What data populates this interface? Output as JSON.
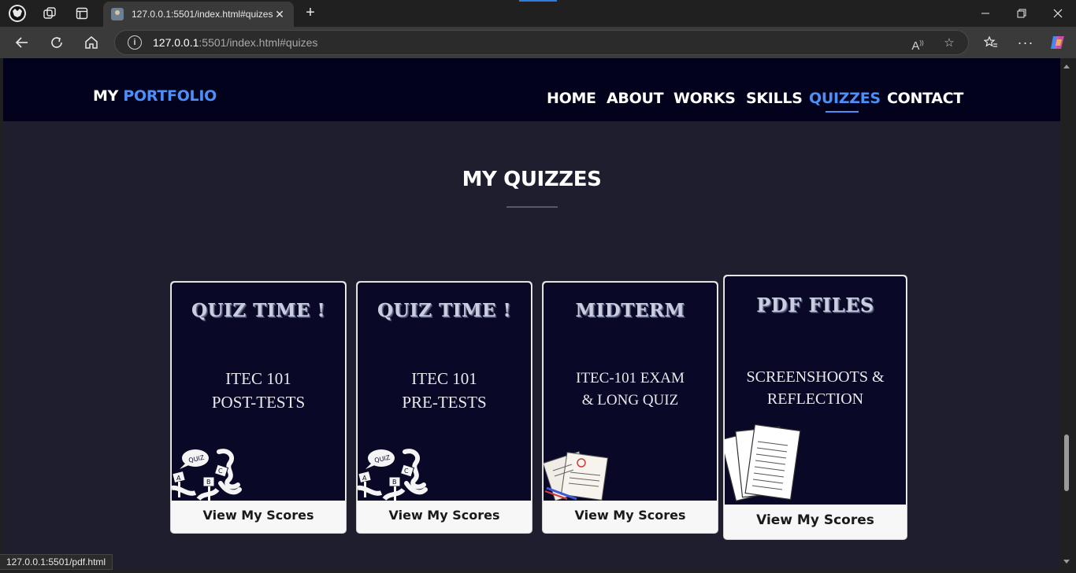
{
  "browser": {
    "tab_title": "127.0.0.1:5501/index.html#quizes",
    "url_host": "127.0.0.1",
    "url_rest": ":5501/index.html#quizes",
    "status_url": "127.0.0.1:5501/pdf.html"
  },
  "site": {
    "logo_prefix": "MY",
    "logo_accent": "PORTFOLIO",
    "accent_color": "#4e8ef7",
    "nav": [
      {
        "label": "HOME"
      },
      {
        "label": "ABOUT"
      },
      {
        "label": "WORKS"
      },
      {
        "label": "SKILLS"
      },
      {
        "label": "QUIZZES",
        "active": true
      },
      {
        "label": "CONTACT"
      }
    ]
  },
  "quizzes": {
    "title": "MY QUIZZES",
    "cards": [
      {
        "heading": "QUIZ TIME !",
        "line1": "ITEC 101",
        "line2": "POST-TESTS",
        "button": "View My Scores",
        "illustration": "quiz-signs-icon"
      },
      {
        "heading": "QUIZ TIME !",
        "line1": "ITEC 101",
        "line2": "PRE-TESTS",
        "button": "View My Scores",
        "illustration": "quiz-signs-icon"
      },
      {
        "heading": "MIDTERM",
        "line1": "ITEC-101 EXAM",
        "line2": "& LONG QUIZ",
        "button": "View My Scores",
        "illustration": "exam-papers-icon"
      },
      {
        "heading": "PDF FILES",
        "line1": "SCREENSHOOTS &",
        "line2": "REFLECTION",
        "button": "View My Scores",
        "illustration": "paper-stack-icon"
      }
    ]
  }
}
